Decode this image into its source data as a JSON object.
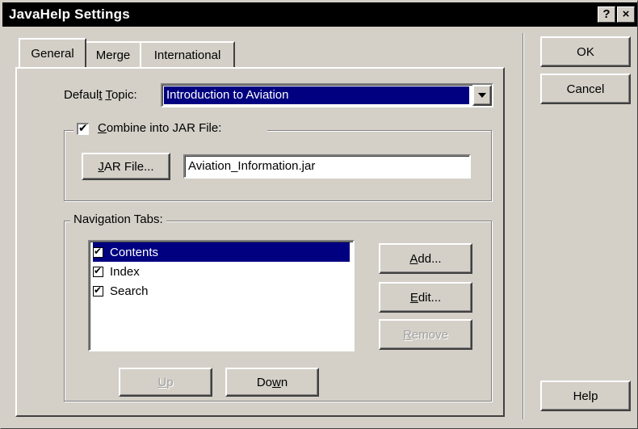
{
  "window": {
    "title": "JavaHelp Settings",
    "help_button": "?",
    "close_button": "×"
  },
  "tabs": [
    {
      "label": "General",
      "active": true
    },
    {
      "label": "Merge",
      "active": false
    },
    {
      "label": "International",
      "active": false
    }
  ],
  "general": {
    "default_topic_label_pre": "Defaul",
    "default_topic_label_key": "t",
    "default_topic_label_post": " ",
    "default_topic_label_key2": "T",
    "default_topic_label_rest": "opic:",
    "default_topic_value": "Introduction to Aviation",
    "combine_jar": {
      "checked": true,
      "label_key": "C",
      "label_rest": "ombine into JAR File:"
    },
    "jar_button_key": "J",
    "jar_button_rest": "AR File...",
    "jar_file_value": "Aviation_Information.jar",
    "navigation_tabs": {
      "legend": "Navigation Tabs:",
      "items": [
        {
          "label": "Contents",
          "checked": true,
          "selected": true
        },
        {
          "label": "Index",
          "checked": true,
          "selected": false
        },
        {
          "label": "Search",
          "checked": true,
          "selected": false
        }
      ],
      "add_key": "A",
      "add_rest": "dd...",
      "edit_key": "E",
      "edit_rest": "dit...",
      "remove_key": "R",
      "remove_rest": "emove",
      "up_key": "U",
      "up_rest": "p",
      "down_pre": "Do",
      "down_key": "w",
      "down_rest": "n"
    }
  },
  "actions": {
    "ok": "OK",
    "cancel": "Cancel",
    "help": "Help"
  },
  "colors": {
    "selection": "#000080",
    "face": "#d4d0c8",
    "titlebar": "#000000"
  }
}
